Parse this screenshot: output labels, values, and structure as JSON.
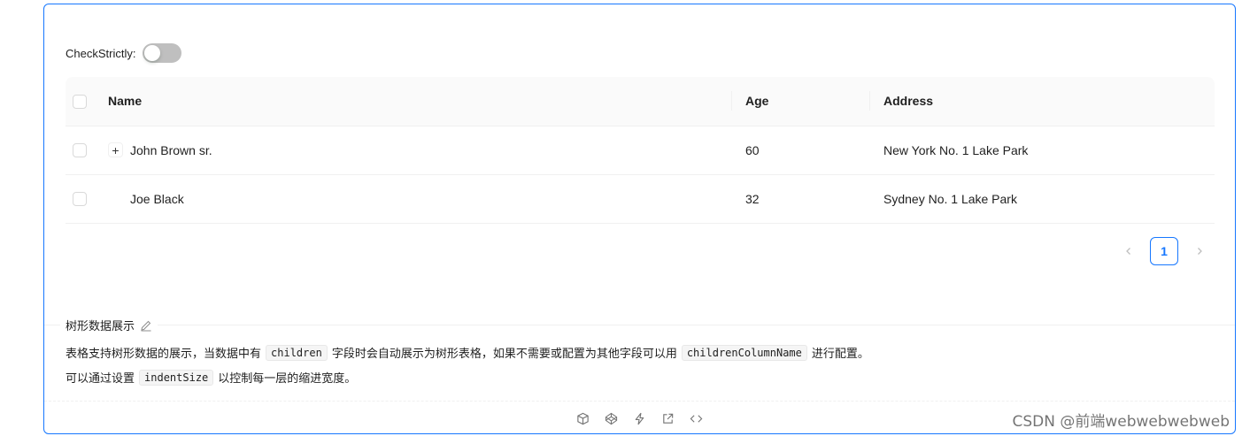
{
  "controls": {
    "check_strictly_label": "CheckStrictly:",
    "check_strictly_on": false
  },
  "table": {
    "columns": [
      "Name",
      "Age",
      "Address"
    ],
    "rows": [
      {
        "name": "John Brown sr.",
        "age": "60",
        "address": "New York No. 1 Lake Park",
        "expandable": true,
        "expand_symbol": "+"
      },
      {
        "name": "Joe Black",
        "age": "32",
        "address": "Sydney No. 1 Lake Park",
        "expandable": false
      }
    ]
  },
  "pagination": {
    "prev": "<",
    "current": "1",
    "next": ">"
  },
  "demo": {
    "title": "树形数据展示",
    "line1_a": "表格支持树形数据的展示，当数据中有",
    "line1_code1": "children",
    "line1_b": "字段时会自动展示为树形表格，如果不需要或配置为其他字段可以用",
    "line1_code2": "childrenColumnName",
    "line1_c": "进行配置。",
    "line2_a": "可以通过设置",
    "line2_code": "indentSize",
    "line2_b": "以控制每一层的缩进宽度。"
  },
  "actions": [
    "codesandbox-icon",
    "codepen-icon",
    "stackblitz-icon",
    "open-external-icon",
    "code-icon"
  ],
  "watermark": "CSDN @前端webwebwebweb",
  "colors": {
    "primary": "#1677ff",
    "switch_off": "#bfbfbf",
    "header_bg": "#fafafa",
    "border": "#f0f0f0"
  }
}
